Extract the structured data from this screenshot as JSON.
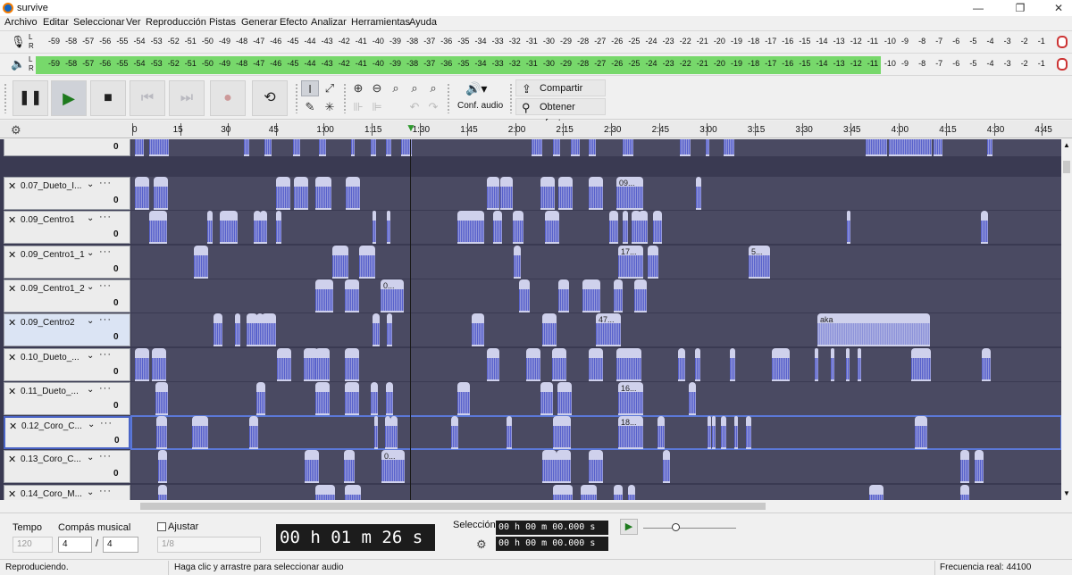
{
  "window": {
    "title": "survive",
    "minimize": "—",
    "maximize": "❐",
    "close": "✕"
  },
  "menu": [
    "Archivo",
    "Editar",
    "Seleccionar",
    "Ver",
    "Reproducción",
    "Pistas",
    "Generar",
    "Efecto",
    "Analizar",
    "Herramientas",
    "Ayuda"
  ],
  "meters": {
    "lr_label": "L\nR",
    "record_ticks": [
      "-59",
      "-58",
      "-57",
      "-56",
      "-55",
      "-54",
      "-53",
      "-52",
      "-51",
      "-50",
      "-49",
      "-48",
      "-47",
      "-46",
      "-45",
      "-44",
      "-43",
      "-42",
      "-41",
      "-40",
      "-39",
      "-38",
      "-37",
      "-36",
      "-35",
      "-34",
      "-33",
      "-32",
      "-31",
      "-30",
      "-29",
      "-28",
      "-27",
      "-26",
      "-25",
      "-24",
      "-23",
      "-22",
      "-21",
      "-20",
      "-19",
      "-18",
      "-17",
      "-16",
      "-15",
      "-14",
      "-13",
      "-12",
      "-11",
      "-10",
      "-9",
      "-8",
      "-7",
      "-6",
      "-5",
      "-4",
      "-3",
      "-2",
      "-1"
    ],
    "play_level_fraction": 0.83,
    "play_color": "#77d86b"
  },
  "toolbar": {
    "audio_setup": "Conf. audio",
    "share_audio": "Compartir audio",
    "get_effects": "Obtener efectos"
  },
  "ruler": {
    "ticks": [
      "0",
      "15",
      "30",
      "45",
      "1:00",
      "1:15",
      "1:30",
      "1:45",
      "2:00",
      "2:15",
      "2:30",
      "2:45",
      "3:00",
      "3:15",
      "3:30",
      "3:45",
      "4:00",
      "4:15",
      "4:30",
      "4:45"
    ]
  },
  "tracks": [
    {
      "name": "",
      "gain": "0"
    },
    {
      "name": "0.07_Dueto_I...",
      "gain": "0"
    },
    {
      "name": "0.09_Centro1",
      "gain": "0"
    },
    {
      "name": "0.09_Centro1_1",
      "gain": "0"
    },
    {
      "name": "0.09_Centro1_2",
      "gain": "0"
    },
    {
      "name": "0.09_Centro2",
      "gain": "0"
    },
    {
      "name": "0.10_Dueto_...",
      "gain": "0"
    },
    {
      "name": "0.11_Dueto_...",
      "gain": "0"
    },
    {
      "name": "0.12_Coro_C...",
      "gain": "0"
    },
    {
      "name": "0.13_Coro_C...",
      "gain": "0"
    },
    {
      "name": "0.14_Coro_M...",
      "gain": "0"
    }
  ],
  "clip_labels": {
    "c1": "09...",
    "c2": "17...",
    "c3": "5...",
    "c4": "0...",
    "c5": "47...",
    "c6": "aka",
    "c7": "16...",
    "c8": "18...",
    "c9": "0..."
  },
  "bottom": {
    "tempo_label": "Tempo",
    "tempo_value": "120",
    "time_sig_label": "Compás musical",
    "time_sig_num": "4",
    "time_sig_slash": "/",
    "time_sig_den": "4",
    "snap_label": "Ajustar",
    "snap_value": "1/8",
    "time": "00 h 01 m 26 s",
    "selection_label": "Selección",
    "sel_start": "00 h 00 m 00.000 s",
    "sel_end": "00 h 00 m 00.000 s"
  },
  "status": {
    "state": "Reproduciendo.",
    "hint": "Haga clic y arrastre para seleccionar audio",
    "rate": "Frecuencia real: 44100"
  }
}
